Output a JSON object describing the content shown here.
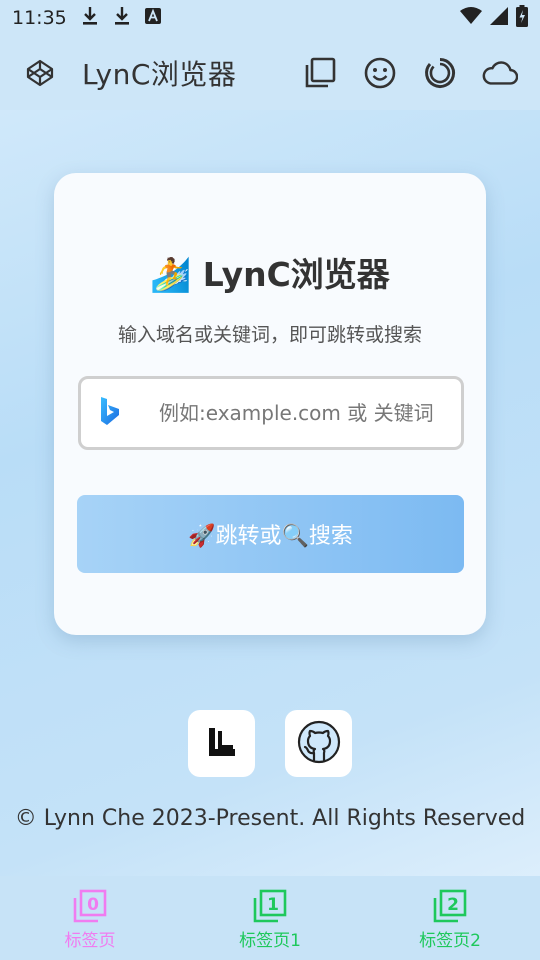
{
  "status": {
    "time": "11:35"
  },
  "app": {
    "title": "LynC浏览器"
  },
  "card": {
    "title": "LynC浏览器",
    "subtitle": "输入域名或关键词，即可跳转或搜索",
    "search_placeholder": "例如:example.com 或 关键词",
    "search_value": "",
    "button_label": "🚀跳转或🔍搜索"
  },
  "footer": {
    "copyright": "© Lynn Che 2023-Present. All Rights Reserved"
  },
  "nav": {
    "tabs": [
      {
        "label": "标签页",
        "number": "0",
        "color": "#f07cf0"
      },
      {
        "label": "标签页1",
        "number": "1",
        "color": "#1ec85c"
      },
      {
        "label": "标签页2",
        "number": "2",
        "color": "#1ec85c"
      }
    ]
  },
  "colors": {
    "accent": "#7cbaf2",
    "app_bar": "#cde6f8"
  },
  "icons": {
    "status": [
      "download-icon",
      "download-icon",
      "font-icon",
      "wifi-icon",
      "signal-icon",
      "battery-icon"
    ],
    "app_bar": [
      "codepen-icon",
      "tabs-icon",
      "smiley-icon",
      "refresh-icon",
      "cloud-icon"
    ],
    "links": [
      "lync-logo-icon",
      "github-icon"
    ]
  }
}
